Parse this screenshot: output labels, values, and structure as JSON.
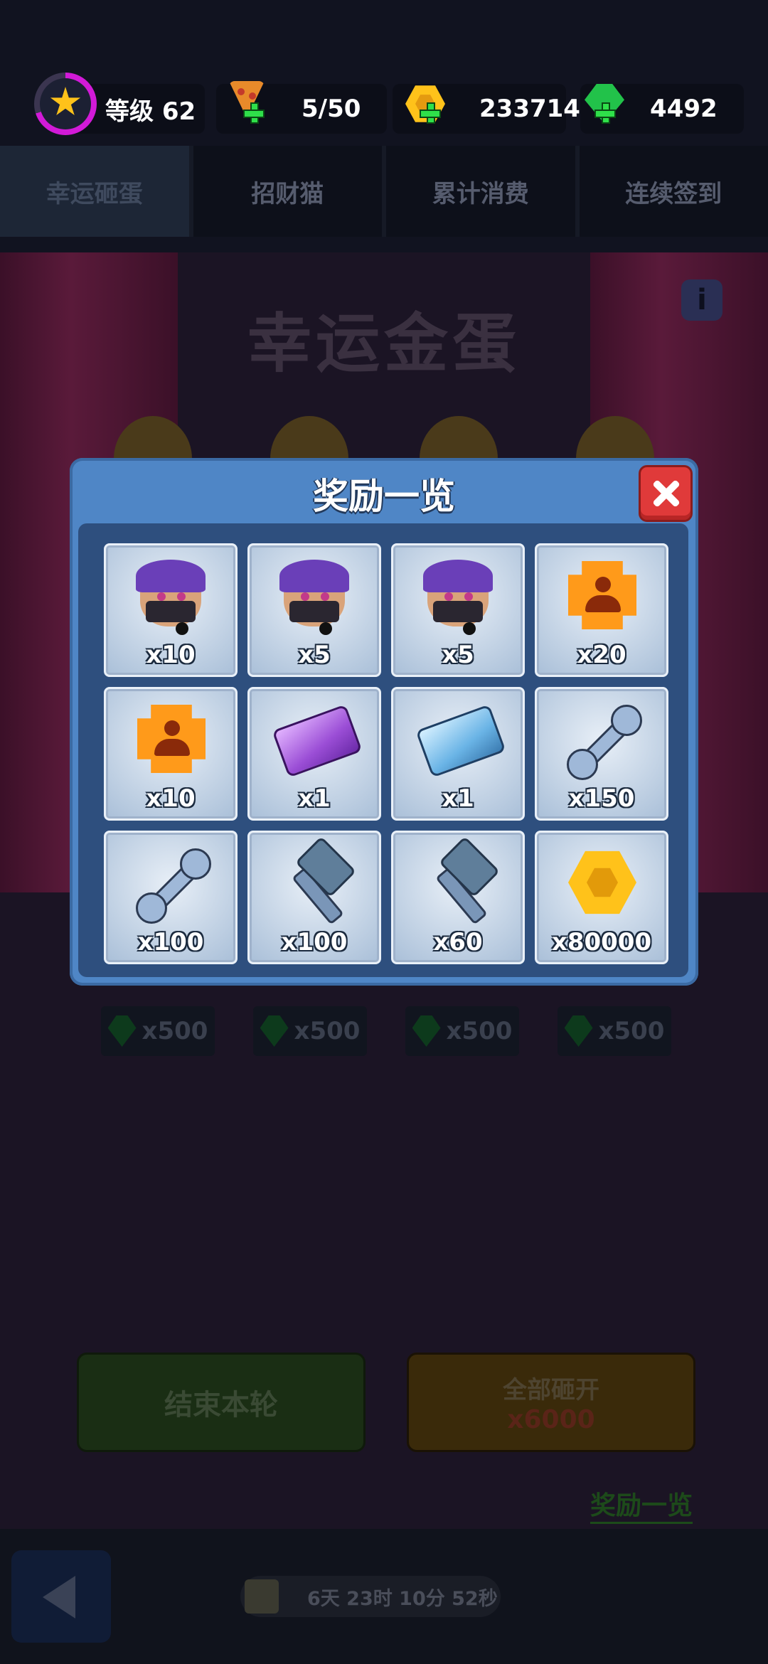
{
  "status": {
    "level_label": "等级 62",
    "stamina": "5/50",
    "gold": "233714",
    "gems": "4492"
  },
  "tabs": [
    {
      "label": "幸运砸蛋",
      "active": true
    },
    {
      "label": "招财猫",
      "active": false
    },
    {
      "label": "累计消费",
      "active": false
    },
    {
      "label": "连续签到",
      "active": false
    }
  ],
  "background": {
    "title": "幸运金蛋",
    "egg_prices": [
      "x500",
      "x500",
      "x500",
      "x500"
    ],
    "end_round_label": "结束本轮",
    "open_all_label": "全部砸开",
    "open_all_cost": "x6000",
    "reward_list_link": "奖励一览",
    "countdown": "6天 23时 10分 52秒"
  },
  "modal": {
    "title": "奖励一览",
    "rewards": [
      {
        "icon": "ninja-hero-icon",
        "qty": "x10"
      },
      {
        "icon": "ninja-hero-icon",
        "qty": "x5"
      },
      {
        "icon": "ninja-hero-icon",
        "qty": "x5"
      },
      {
        "icon": "hero-badge-icon",
        "qty": "x20"
      },
      {
        "icon": "hero-badge-icon",
        "qty": "x10"
      },
      {
        "icon": "purple-ingot-icon",
        "qty": "x1"
      },
      {
        "icon": "blue-ingot-icon",
        "qty": "x1"
      },
      {
        "icon": "wrench-icon",
        "qty": "x150"
      },
      {
        "icon": "wrench-icon",
        "qty": "x100"
      },
      {
        "icon": "hammer-icon",
        "qty": "x100"
      },
      {
        "icon": "hammer-icon",
        "qty": "x60"
      },
      {
        "icon": "gold-coin-icon",
        "qty": "x80000"
      }
    ]
  },
  "colors": {
    "modal_bg": "#4f86c6",
    "close_button": "#e03a3a",
    "accent_gem": "#22c24a",
    "accent_gold": "#ffc21a"
  }
}
